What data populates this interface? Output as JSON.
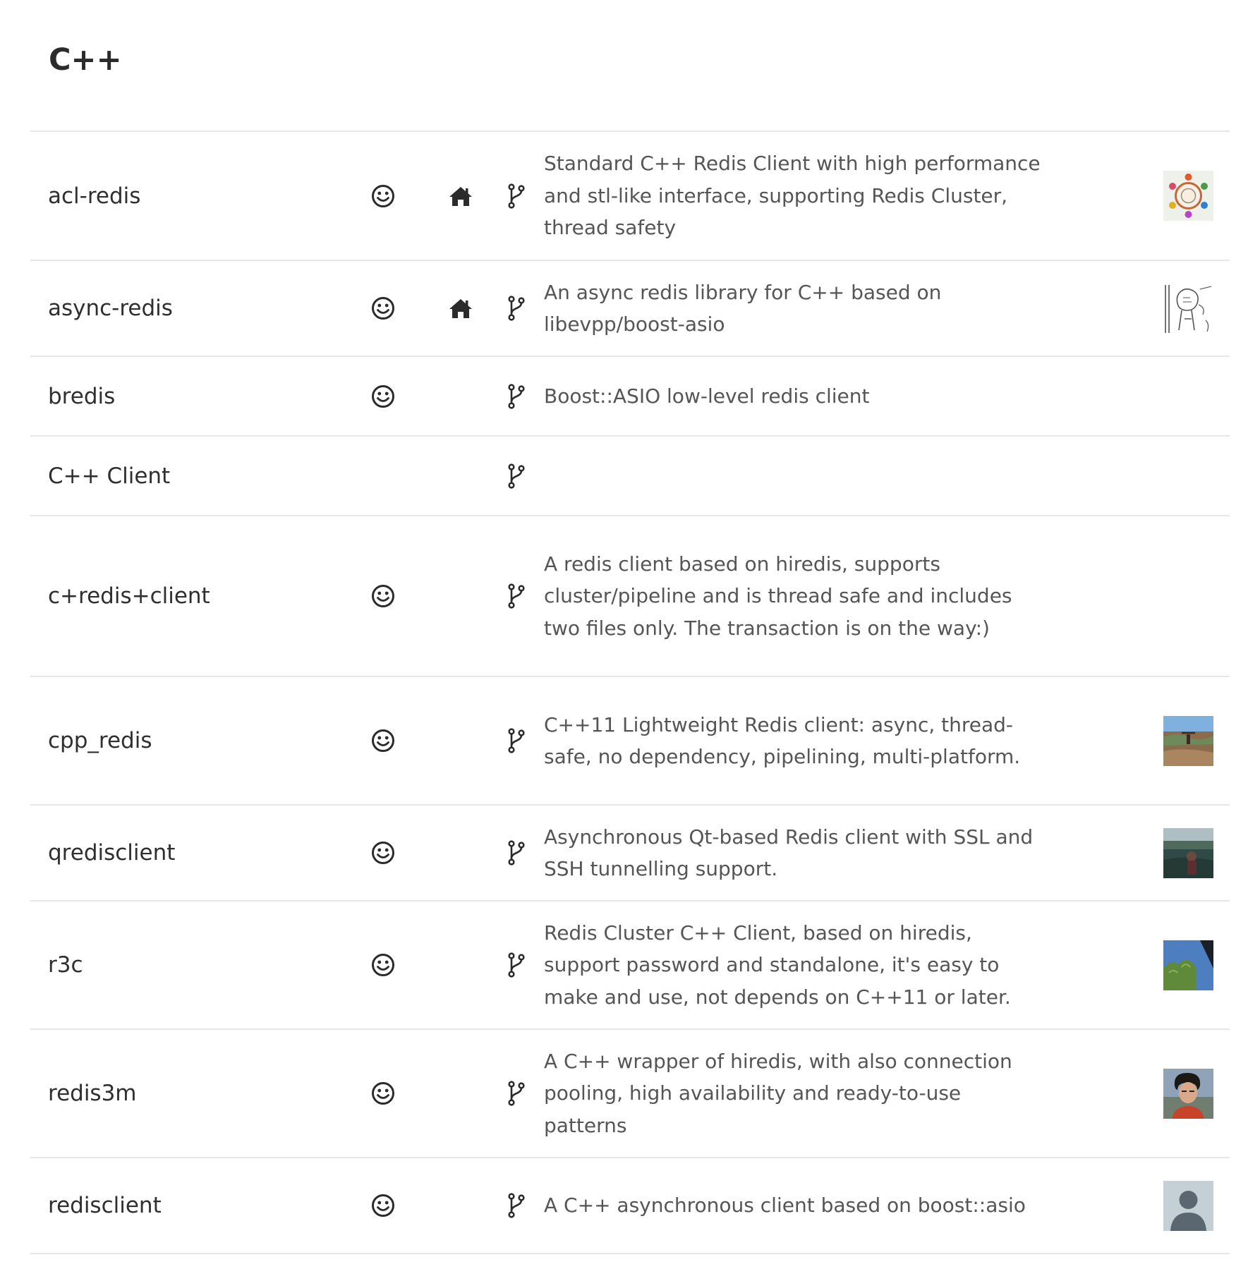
{
  "section": {
    "title": "C++"
  },
  "clients": [
    {
      "name": "acl-redis",
      "recommended": true,
      "homepage": true,
      "repository": true,
      "description": "Standard C++ Redis Client with high performance and stl-like interface, supporting Redis Cluster, thread safety",
      "avatar": "colorful-diagram",
      "row_height": 183
    },
    {
      "name": "async-redis",
      "recommended": true,
      "homepage": true,
      "repository": true,
      "description": "An async redis library for C++ based on libevpp/boost-asio",
      "avatar": "sketch-drawing",
      "row_height": 136
    },
    {
      "name": "bredis",
      "recommended": true,
      "homepage": false,
      "repository": true,
      "description": "Boost::ASIO low-level redis client",
      "avatar": "",
      "row_height": 113
    },
    {
      "name": "C++ Client",
      "recommended": false,
      "homepage": false,
      "repository": true,
      "description": "",
      "avatar": "",
      "row_height": 113
    },
    {
      "name": "c+redis+client",
      "recommended": true,
      "homepage": false,
      "repository": true,
      "description": "A redis client based on hiredis, supports cluster/pipeline and is thread safe and includes two files only. The transaction is on the way:)",
      "avatar": "",
      "row_height": 228
    },
    {
      "name": "cpp_redis",
      "recommended": true,
      "homepage": false,
      "repository": true,
      "description": "C++11 Lightweight Redis client: async, thread-safe, no dependency, pipelining, multi-platform.",
      "avatar": "landscape-photo",
      "row_height": 182
    },
    {
      "name": "qredisclient",
      "recommended": true,
      "homepage": false,
      "repository": true,
      "description": "Asynchronous Qt-based Redis client with SSL and SSH tunnelling support.",
      "avatar": "water-photo",
      "row_height": 136
    },
    {
      "name": "r3c",
      "recommended": true,
      "homepage": false,
      "repository": true,
      "description": "Redis Cluster C++ Client, based on hiredis, support password and standalone, it's easy to make and use, not depends on C++11 or later.",
      "avatar": "sky-photo",
      "row_height": 182
    },
    {
      "name": "redis3m",
      "recommended": true,
      "homepage": false,
      "repository": true,
      "description": "A C++ wrapper of hiredis, with also connection pooling, high availability and ready-to-use patterns",
      "avatar": "person-photo",
      "row_height": 182
    },
    {
      "name": "redisclient",
      "recommended": true,
      "homepage": false,
      "repository": true,
      "description": "A C++ asynchronous client based on boost::asio",
      "avatar": "default-user",
      "row_height": 136
    }
  ]
}
